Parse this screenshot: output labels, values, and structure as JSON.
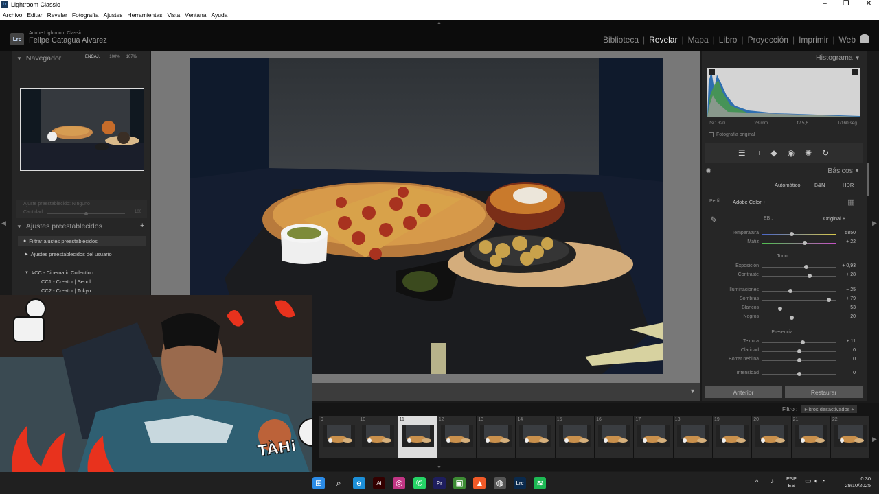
{
  "window": {
    "title": "Lightroom Classic",
    "controls": [
      "–",
      "❐",
      "✕"
    ]
  },
  "menu": [
    "Archivo",
    "Editar",
    "Revelar",
    "Fotografía",
    "Ajustes",
    "Herramientas",
    "Vista",
    "Ventana",
    "Ayuda"
  ],
  "identity": {
    "small": "Adobe Lightroom Classic",
    "name": "Felipe Catagua Alvarez",
    "logo": "Lrc"
  },
  "modules": [
    "Biblioteca",
    "Revelar",
    "Mapa",
    "Libro",
    "Proyección",
    "Imprimir",
    "Web"
  ],
  "active_module": "Revelar",
  "navigator": {
    "title": "Navegador",
    "zoom": [
      "ENCAJ. ÷",
      "100%",
      "107% ÷"
    ]
  },
  "preset_amount": {
    "label": "Ajuste preestablecido",
    "value": "Ninguno",
    "qty_label": "Cantidad",
    "qty_value": "100"
  },
  "presets": {
    "title": "Ajustes preestablecidos",
    "add": "+",
    "filter": "Filtrar ajustes preestablecidos",
    "user": "Ajustes preestablecidos del usuario",
    "collection": "#CC - Cinematic Collection",
    "items": [
      "CC1 - Creator | Seoul",
      "CC2 - Creator | Tokyo"
    ]
  },
  "histogram": {
    "title": "Histograma",
    "iso": "ISO 320",
    "focal": "28 mm",
    "aperture": "f / 5,6",
    "shutter": "1/160 seg",
    "original_photo": "Fotografía original"
  },
  "tools": [
    "sliders-icon",
    "crop-icon",
    "heal-icon",
    "redeye-icon",
    "mask-icon",
    "history-icon"
  ],
  "basic": {
    "title": "Básicos",
    "modes": [
      "Automático",
      "B&N",
      "HDR"
    ],
    "profile_label": "Perfil :",
    "profile_value": "Adobe Color ÷",
    "wb_label": "EB :",
    "wb_value": "Original ÷",
    "tone_head": "Tono",
    "presence_head": "Presencia",
    "wb_sliders": [
      {
        "label": "Temperatura",
        "value": "5850",
        "pos": 0.4
      },
      {
        "label": "Matiz",
        "value": "+ 22",
        "pos": 0.57
      }
    ],
    "tone_sliders": [
      {
        "label": "Exposición",
        "value": "+ 0,93",
        "pos": 0.59
      },
      {
        "label": "Contraste",
        "value": "+ 28",
        "pos": 0.64
      },
      {
        "label": "Iluminaciones",
        "value": "− 25",
        "pos": 0.38
      },
      {
        "label": "Sombras",
        "value": "+ 79",
        "pos": 0.9
      },
      {
        "label": "Blancos",
        "value": "− 53",
        "pos": 0.24
      },
      {
        "label": "Negros",
        "value": "− 20",
        "pos": 0.4
      }
    ],
    "presence_sliders": [
      {
        "label": "Textura",
        "value": "+ 11",
        "pos": 0.55
      },
      {
        "label": "Claridad",
        "value": "0",
        "pos": 0.5
      },
      {
        "label": "Borrar neblina",
        "value": "0",
        "pos": 0.5
      },
      {
        "label": "Intensidad",
        "value": "0",
        "pos": 0.5
      }
    ]
  },
  "buttons": {
    "prev": "Anterior",
    "reset": "Restaurar"
  },
  "filter": {
    "label": "Filtro :",
    "value": "Filtros desactivados ÷"
  },
  "filmstrip": {
    "numbers": [
      "9",
      "10",
      "11",
      "12",
      "13",
      "14",
      "15",
      "16",
      "17",
      "18",
      "19",
      "20",
      "21",
      "22"
    ],
    "selected": "11"
  },
  "overlay": {
    "text": "TÀHi"
  },
  "taskbar": {
    "lang": "ESP",
    "lang2": "ES",
    "time": "0:30",
    "date": "29/10/2025",
    "icons": [
      "windows-icon",
      "search-icon",
      "edge-icon",
      "illustrator-icon",
      "instagram-icon",
      "whatsapp-icon",
      "premiere-icon",
      "minecraft-icon",
      "brave-icon",
      "chrome-icon",
      "lightroom-icon",
      "spotify-icon"
    ]
  },
  "colors": {
    "accent": "#e8e8e8",
    "panel": "#262626",
    "stage": "#787878"
  }
}
